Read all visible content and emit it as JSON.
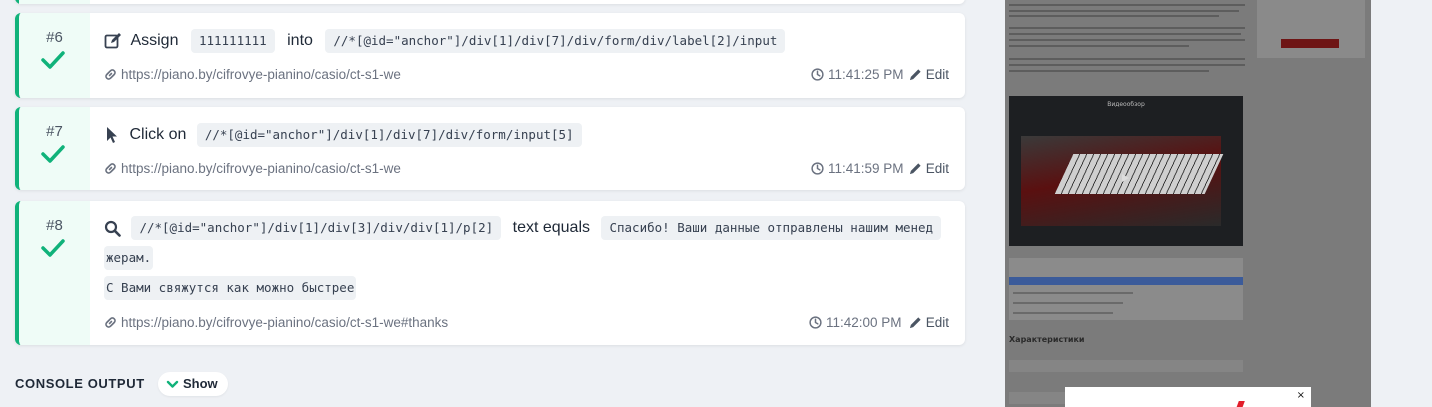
{
  "steps": [
    {
      "number": "#6",
      "action_icon": "edit-icon",
      "action_word": "Assign",
      "value": "111111111",
      "connector": "into",
      "selector": "//*[@id=\"anchor\"]/div[1]/div[7]/div/form/div/label[2]/input",
      "url": "https://piano.by/cifrovye-pianino/casio/ct-s1-we",
      "time": "11:41:25 PM",
      "edit_label": "Edit",
      "status": "passed"
    },
    {
      "number": "#7",
      "action_icon": "cursor-icon",
      "action_word": "Click on",
      "selector": "//*[@id=\"anchor\"]/div[1]/div[7]/div/form/input[5]",
      "url": "https://piano.by/cifrovye-pianino/casio/ct-s1-we",
      "time": "11:41:59 PM",
      "edit_label": "Edit",
      "status": "passed"
    },
    {
      "number": "#8",
      "action_icon": "search-icon",
      "selector": "//*[@id=\"anchor\"]/div[1]/div[3]/div/div[1]/p[2]",
      "connector": "text equals",
      "expected_line1": "Спасибо! Ваши данные отправлены нашим менед",
      "expected_line2": "жерам.",
      "expected_line3": "С Вами свяжутся как можно быстрее",
      "url": "https://piano.by/cifrovye-pianino/casio/ct-s1-we#thanks",
      "time": "11:42:00 PM",
      "edit_label": "Edit",
      "status": "passed"
    }
  ],
  "console": {
    "label": "CONSOLE OUTPUT",
    "toggle_label": "Show"
  },
  "screenshot": {
    "video_title": "Видеообзор",
    "spec_heading": "Характеристики",
    "modal_close": "×"
  },
  "colors": {
    "accent_green": "#10b27a",
    "status_green_bg": "#effcf7",
    "code_bg": "#eef1f4",
    "page_bg": "#eef1f5"
  }
}
